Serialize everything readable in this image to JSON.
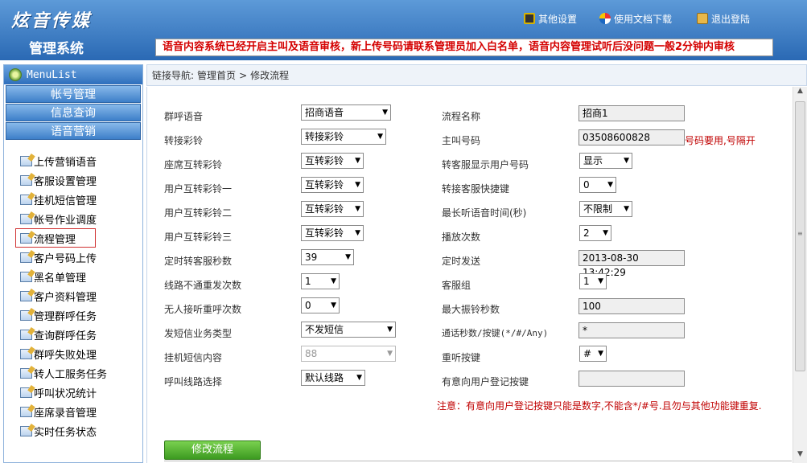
{
  "header": {
    "logo_text": "炫音传媒",
    "system_name": "管理系统",
    "links": {
      "settings": "其他设置",
      "docs": "使用文档下载",
      "logout": "退出登陆"
    },
    "notice": "语音内容系统已经开启主叫及语音审核，新上传号码请联系管理员加入白名单，语音内容管理试听后没问题一般2分钟内审核"
  },
  "sidebar": {
    "title": "MenuList",
    "groups": [
      "帐号管理",
      "信息查询",
      "语音营销"
    ],
    "items": [
      "上传营销语音",
      "客服设置管理",
      "挂机短信管理",
      "帐号作业调度",
      "流程管理",
      "客户号码上传",
      "黑名单管理",
      "客户资料管理",
      "管理群呼任务",
      "查询群呼任务",
      "群呼失败处理",
      "转人工服务任务",
      "呼叫状况统计",
      "座席录音管理",
      "实时任务状态"
    ],
    "active_index": 4
  },
  "breadcrumb": {
    "prefix": "链接导航:",
    "home": "管理首页",
    "sep": ">",
    "current": "修改流程"
  },
  "form": {
    "left": [
      {
        "label": "群呼语音",
        "value": "招商语音"
      },
      {
        "label": "转接彩铃",
        "value": "转接彩铃"
      },
      {
        "label": "座席互转彩铃",
        "value": "互转彩铃"
      },
      {
        "label": "用户互转彩铃一",
        "value": "互转彩铃"
      },
      {
        "label": "用户互转彩铃二",
        "value": "互转彩铃"
      },
      {
        "label": "用户互转彩铃三",
        "value": "互转彩铃"
      },
      {
        "label": "定时转客服秒数",
        "value": "39"
      },
      {
        "label": "线路不通重发次数",
        "value": "1"
      },
      {
        "label": "无人接听重呼次数",
        "value": "0"
      },
      {
        "label": "发短信业务类型",
        "value": "不发短信"
      },
      {
        "label": "挂机短信内容",
        "value": "88"
      },
      {
        "label": "呼叫线路选择",
        "value": "默认线路"
      }
    ],
    "right": [
      {
        "label": "流程名称",
        "value": "招商1"
      },
      {
        "label": "主叫号码",
        "value": "03508600828"
      },
      {
        "label": "转客服显示用户号码",
        "value": "显示"
      },
      {
        "label": "转接客服快捷键",
        "value": "0"
      },
      {
        "label": "最长听语音时间(秒)",
        "value": "不限制"
      },
      {
        "label": "播放次数",
        "value": "2"
      },
      {
        "label": "定时发送",
        "value": "2013-08-30 13:42:29"
      },
      {
        "label": "客服组",
        "value": "1"
      },
      {
        "label": "最大振铃秒数",
        "value": "100"
      },
      {
        "label": "通话秒数/按键(*/#/Any)",
        "value": "*"
      },
      {
        "label": "重听按键",
        "value": "#"
      },
      {
        "label": "有意向用户登记按键",
        "value": ""
      }
    ],
    "caller_hint": "号码要用,号隔开",
    "note": "注意：有意向用户登记按键只能是数字,不能含*/#号.且勿与其他功能键重复.",
    "submit_label": "修改流程"
  }
}
